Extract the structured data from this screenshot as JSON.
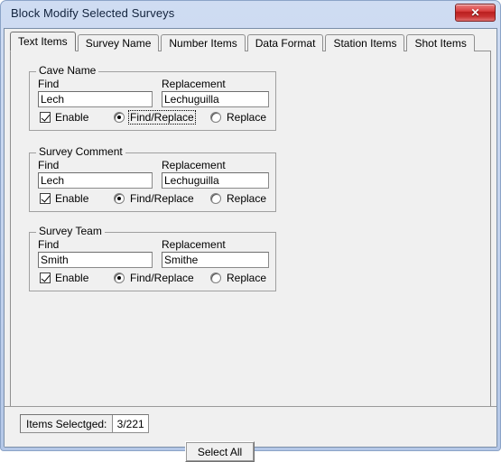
{
  "window": {
    "title": "Block Modify Selected Surveys",
    "close_label": "✕",
    "close_icon": "close-icon"
  },
  "tabs": [
    {
      "label": "Text Items",
      "active": true
    },
    {
      "label": "Survey Name",
      "active": false
    },
    {
      "label": "Number Items",
      "active": false
    },
    {
      "label": "Data Format",
      "active": false
    },
    {
      "label": "Station Items",
      "active": false
    },
    {
      "label": "Shot Items",
      "active": false
    }
  ],
  "groups": [
    {
      "title": "Cave Name",
      "find_label": "Find",
      "find_value": "Lech",
      "replacement_label": "Replacement",
      "replacement_value": "Lechuguilla",
      "enable_label": "Enable",
      "enable_checked": true,
      "find_replace_label": "Find/Replace",
      "replace_label": "Replace",
      "mode": "find_replace",
      "focused": true
    },
    {
      "title": "Survey Comment",
      "find_label": "Find",
      "find_value": "Lech",
      "replacement_label": "Replacement",
      "replacement_value": "Lechuguilla",
      "enable_label": "Enable",
      "enable_checked": true,
      "find_replace_label": "Find/Replace",
      "replace_label": "Replace",
      "mode": "find_replace",
      "focused": false
    },
    {
      "title": "Survey Team",
      "find_label": "Find",
      "find_value": "Smith",
      "replacement_label": "Replacement",
      "replacement_value": "Smithe",
      "enable_label": "Enable",
      "enable_checked": true,
      "find_replace_label": "Find/Replace",
      "replace_label": "Replace",
      "mode": "find_replace",
      "focused": false
    }
  ],
  "status": {
    "items_label": "Items Selectged:",
    "items_value": "3/221",
    "select_all_label": "Select All"
  },
  "colors": {
    "frame": "#b4c7e7",
    "face": "#f0f0f0",
    "close_red": "#c93232",
    "field_bg": "#ffffff",
    "border": "#8f8f8f"
  }
}
